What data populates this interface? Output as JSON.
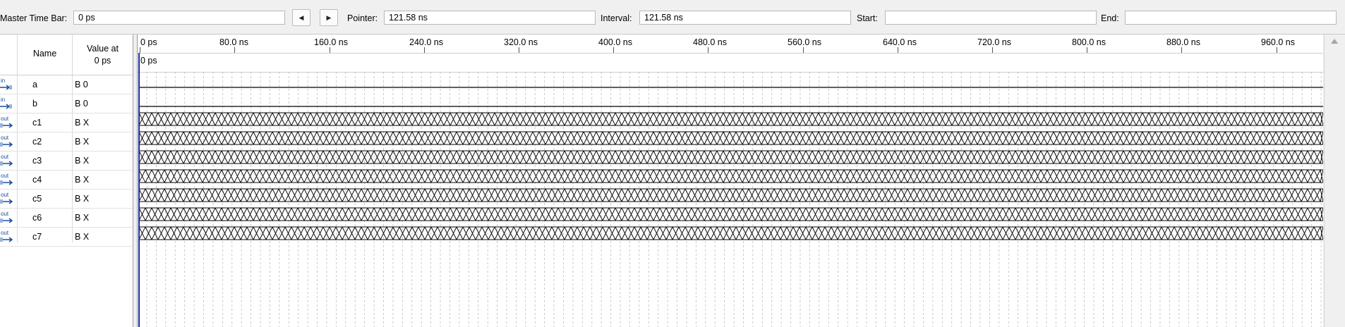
{
  "toolbar": {
    "master_time_bar_label": "Master Time Bar:",
    "master_time_bar_value": "0 ps",
    "pointer_label": "Pointer:",
    "pointer_value": "121.58 ns",
    "interval_label": "Interval:",
    "interval_value": "121.58 ns",
    "start_label": "Start:",
    "start_value": "",
    "end_label": "End:",
    "end_value": "",
    "prev_button": "◀",
    "next_button": "▶"
  },
  "signal_list": {
    "name_header": "Name",
    "value_header_line1": "Value at",
    "value_header_line2": "0 ps",
    "signals": [
      {
        "type": "in",
        "name": "a",
        "value": "B 0"
      },
      {
        "type": "in",
        "name": "b",
        "value": "B 0"
      },
      {
        "type": "out",
        "name": "c1",
        "value": "B X"
      },
      {
        "type": "out",
        "name": "c2",
        "value": "B X"
      },
      {
        "type": "out",
        "name": "c3",
        "value": "B X"
      },
      {
        "type": "out",
        "name": "c4",
        "value": "B X"
      },
      {
        "type": "out",
        "name": "c5",
        "value": "B X"
      },
      {
        "type": "out",
        "name": "c6",
        "value": "B X"
      },
      {
        "type": "out",
        "name": "c7",
        "value": "B X"
      }
    ]
  },
  "timeline": {
    "ticks": [
      "0 ps",
      "80.0 ns",
      "160.0 ns",
      "240.0 ns",
      "320.0 ns",
      "400.0 ns",
      "480.0 ns",
      "560.0 ns",
      "640.0 ns",
      "720.0 ns",
      "800.0 ns",
      "880.0 ns",
      "960.0 ns"
    ],
    "marker_label": "0 ps"
  },
  "colors": {
    "cursor": "#1c2d9c",
    "wave_line": "#000000",
    "grid_line": "#bdbdbd",
    "icon_blue": "#1b4fa0"
  }
}
